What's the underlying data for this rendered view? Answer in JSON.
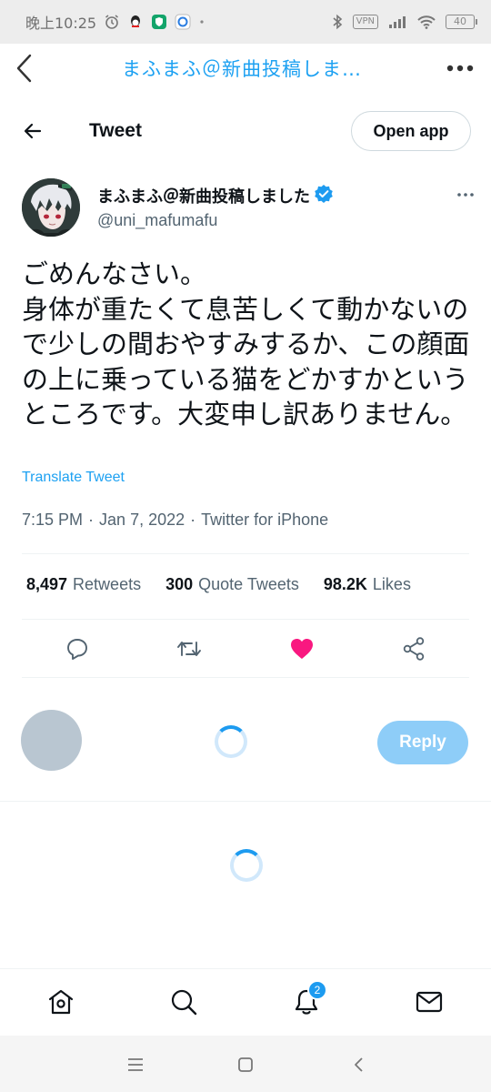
{
  "status_bar": {
    "time": "晚上10:25",
    "vpn_label": "VPN",
    "battery_level": "40",
    "icons": [
      "alarm-icon",
      "qq-icon",
      "shield-app-icon",
      "app-icon",
      "bluetooth-icon",
      "signal-icon",
      "wifi-icon",
      "battery-icon"
    ]
  },
  "app_bar": {
    "title": "まふまふ＠新曲投稿しま…"
  },
  "tweet_header": {
    "title": "Tweet",
    "open_app_label": "Open app"
  },
  "author": {
    "name": "まふまふ＠新曲投稿しました",
    "handle": "@uni_mafumafu",
    "verified": true
  },
  "tweet": {
    "text": "ごめんなさい。\n身体が重たくて息苦しくて動かないので少しの間おやすみするか、この顔面の上に乗っている猫をどかすかというところです。大変申し訳ありません。",
    "translate_label": "Translate Tweet",
    "time": "7:15 PM",
    "separator": "·",
    "date": "Jan 7, 2022",
    "source": "Twitter for iPhone"
  },
  "stats": {
    "retweets_count": "8,497",
    "retweets_label": "Retweets",
    "quotes_count": "300",
    "quotes_label": "Quote Tweets",
    "likes_count": "98.2K",
    "likes_label": "Likes"
  },
  "actions": {
    "liked": true,
    "like_color": "#f91880"
  },
  "reply": {
    "button_label": "Reply"
  },
  "bottom_nav": {
    "notification_count": "2"
  },
  "colors": {
    "accent": "#1da1f2",
    "reply_disabled": "#8ecdf8"
  }
}
